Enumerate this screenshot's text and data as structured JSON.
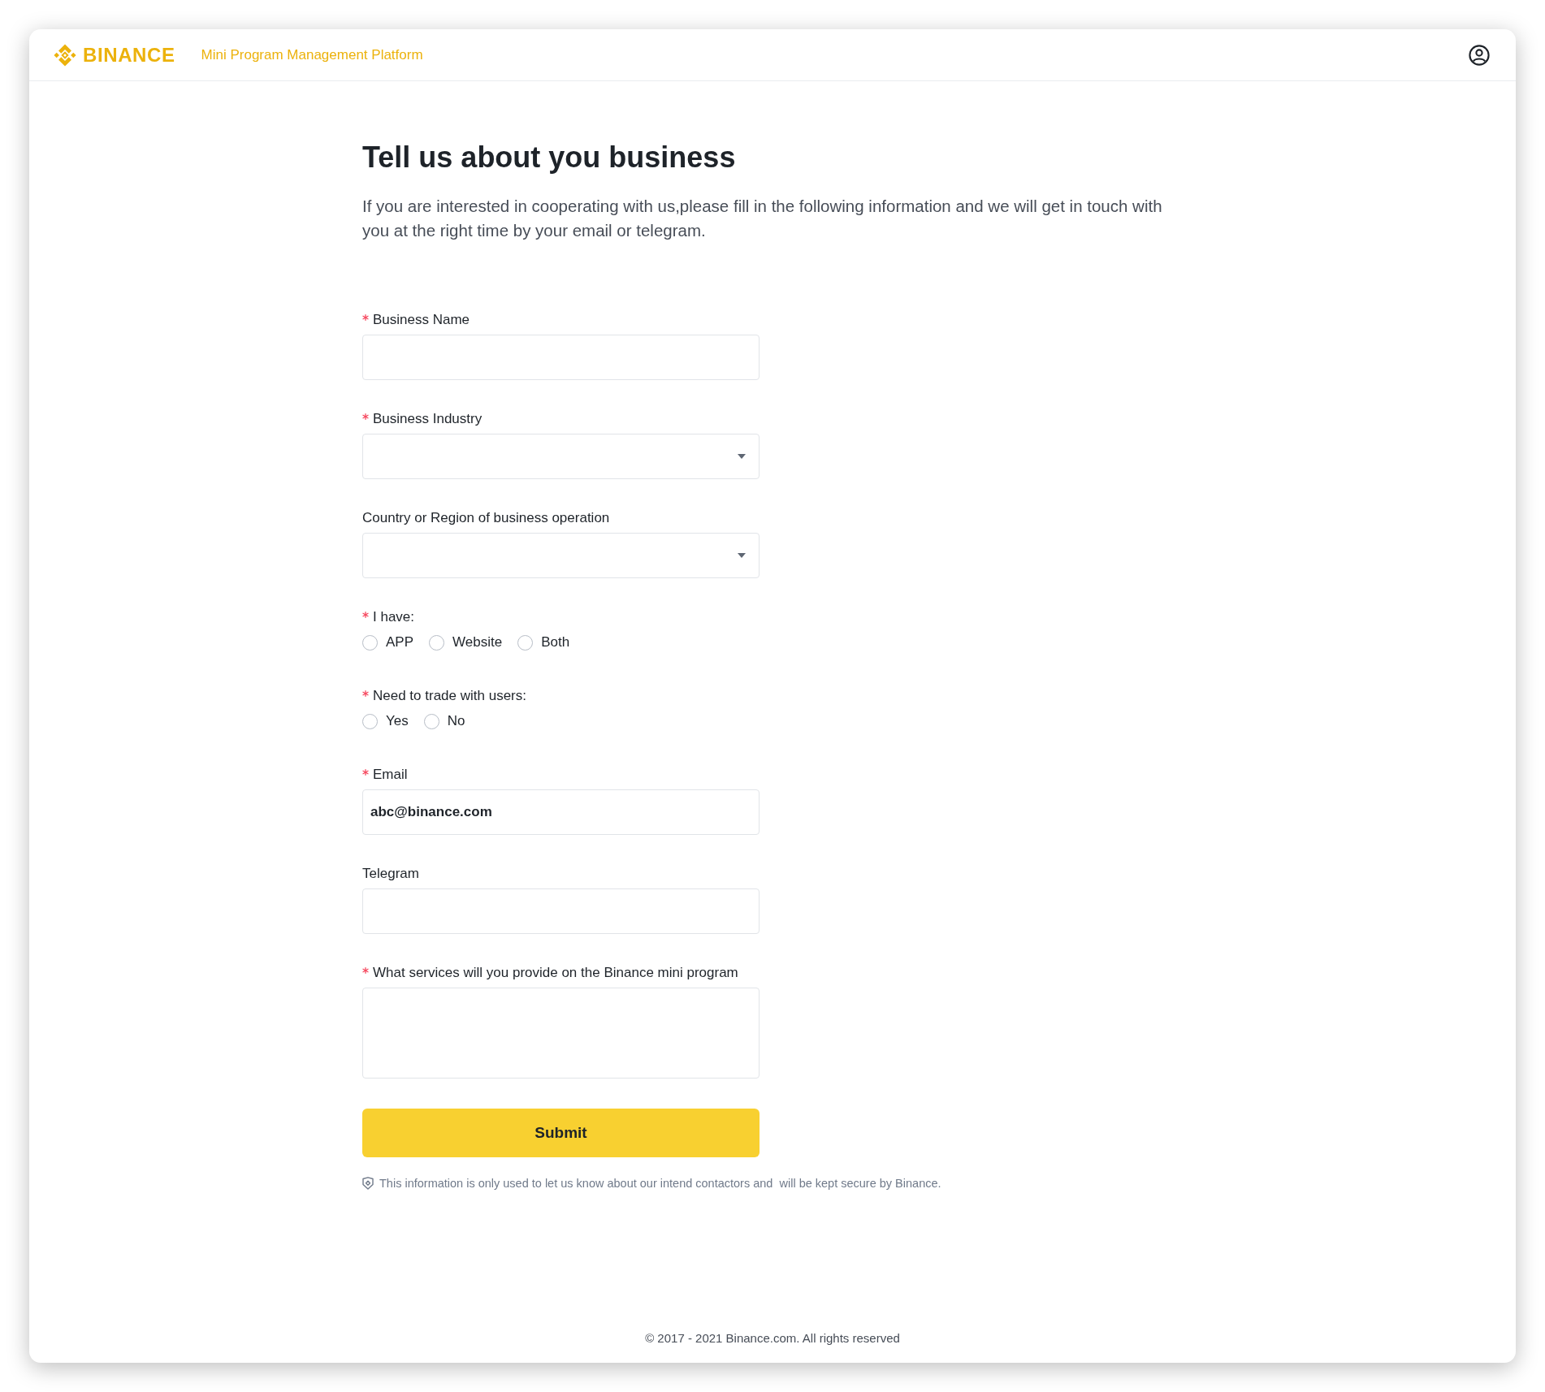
{
  "header": {
    "brand": "BINANCE",
    "platform_title": "Mini Program Management Platform"
  },
  "intro": {
    "title": "Tell us about you business",
    "text": "If you are interested in cooperating with us,please fill in the following information and we will get in touch with you at the right time by your email or telegram."
  },
  "form": {
    "fields": [
      {
        "kind": "text",
        "label": "Business Name",
        "required": true
      },
      {
        "kind": "select",
        "label": "Business Industry",
        "required": true
      },
      {
        "kind": "select",
        "label": "Country or Region of business operation",
        "required": false
      },
      {
        "kind": "radio",
        "label": "I have:",
        "required": true,
        "options": [
          {
            "label": "APP",
            "selected": false
          },
          {
            "label": "Website",
            "selected": false
          },
          {
            "label": "Both",
            "selected": false
          }
        ]
      },
      {
        "kind": "radio",
        "label": "Need to trade with users:",
        "required": true,
        "options": [
          {
            "label": "Yes",
            "selected": false
          },
          {
            "label": "No",
            "selected": false
          }
        ]
      },
      {
        "kind": "text",
        "label": "Email",
        "required": true,
        "value": "abc@binance.com"
      },
      {
        "kind": "text",
        "label": "Telegram",
        "required": false
      },
      {
        "kind": "textarea",
        "label": "What services will you provide on the Binance mini program",
        "required": true
      }
    ],
    "submit_button": "Submit",
    "security_note": "This information is only used to let us know about our intend contactors and  will be kept secure by Binance."
  },
  "footer": {
    "copyright": "© 2017 - 2021 Binance.com. All rights reserved"
  }
}
